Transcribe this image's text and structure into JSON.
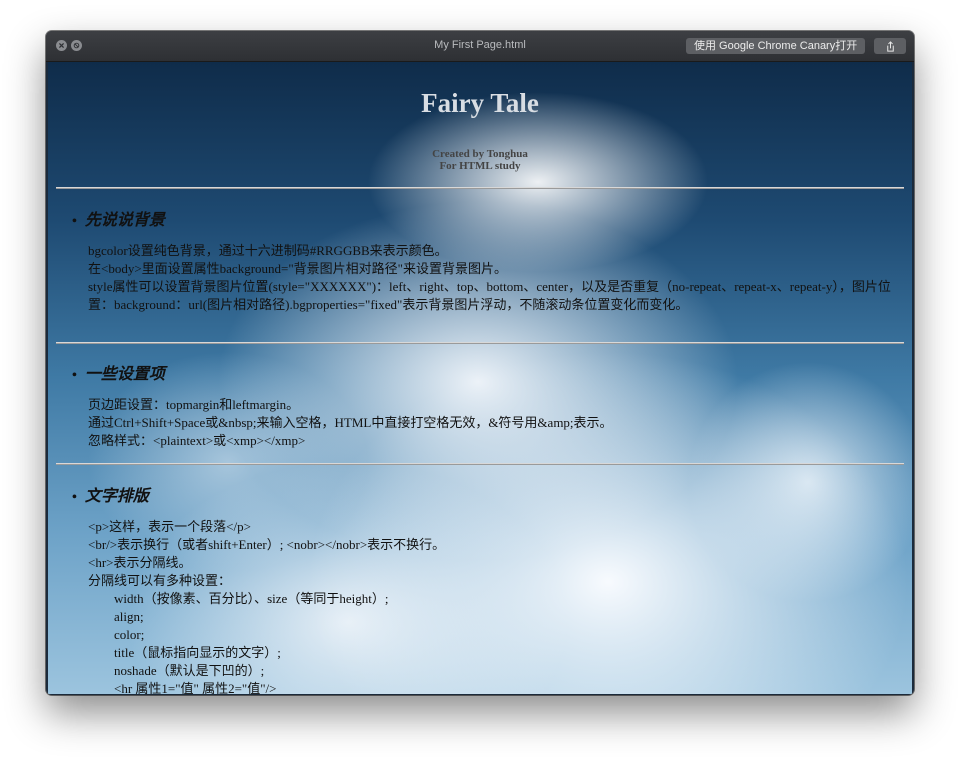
{
  "window": {
    "title": "My First Page.html",
    "open_button_label": "使用 Google Chrome Canary打开"
  },
  "page": {
    "title": "Fairy Tale",
    "subtitle_line1": "Created by Tonghua",
    "subtitle_line2": "For HTML study"
  },
  "sections": [
    {
      "heading": "先说说背景",
      "lines": [
        "bgcolor设置纯色背景，通过十六进制码#RRGGBB来表示颜色。",
        "在<body>里面设置属性background=\"背景图片相对路径\"来设置背景图片。",
        "style属性可以设置背景图片位置(style=\"XXXXXX\")：left、right、top、bottom、center，以及是否重复（no-repeat、repeat-x、repeat-y），图片位置：background：url(图片相对路径).bgproperties=\"fixed\"表示背景图片浮动，不随滚动条位置变化而变化。"
      ]
    },
    {
      "heading": "一些设置项",
      "lines": [
        "页边距设置：topmargin和leftmargin。",
        "通过Ctrl+Shift+Space或&nbsp;来输入空格，HTML中直接打空格无效，&符号用&amp;表示。",
        "忽略样式：<plaintext>或<xmp></xmp>"
      ]
    },
    {
      "heading": "文字排版",
      "lines": [
        "<p>这样，表示一个段落</p>",
        "<br/>表示换行（或者shift+Enter）; <nobr></nobr>表示不换行。",
        "<hr>表示分隔线。",
        "分隔线可以有多种设置："
      ],
      "sub_lines": [
        "width（按像素、百分比）、size（等同于height）;",
        "align;",
        "color;",
        "title（鼠标指向显示的文字）;",
        "noshade（默认是下凹的）;",
        "<hr 属性1=\"值\" 属性2=\"值\"/>"
      ]
    }
  ],
  "colors": {
    "sky_top": "#0f2c4a",
    "sky_bottom": "#9cc4de",
    "titlebar": "#2e3034"
  }
}
